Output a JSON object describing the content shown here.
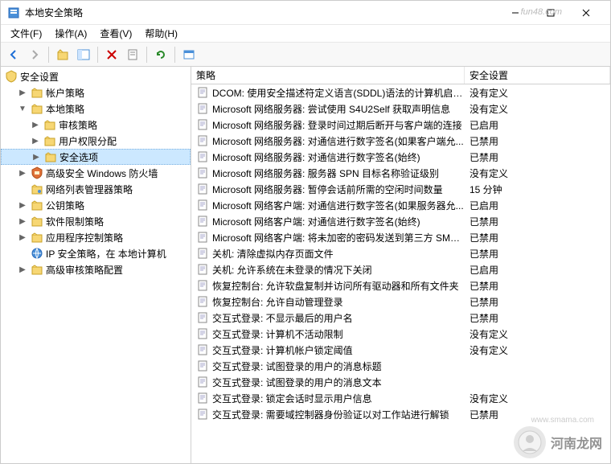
{
  "window": {
    "title": "本地安全策略"
  },
  "watermarks": {
    "top": "fun48.com",
    "bottom_url": "www.smama.com",
    "bottom_text": "河南龙网"
  },
  "menu": {
    "file": "文件(F)",
    "action": "操作(A)",
    "view": "查看(V)",
    "help": "帮助(H)"
  },
  "tree": {
    "root": "安全设置",
    "items": [
      {
        "label": "帐户策略",
        "indent": 1,
        "expander": "▶",
        "icon": "folder"
      },
      {
        "label": "本地策略",
        "indent": 1,
        "expander": "▼",
        "icon": "folder"
      },
      {
        "label": "审核策略",
        "indent": 2,
        "expander": "▶",
        "icon": "folder"
      },
      {
        "label": "用户权限分配",
        "indent": 2,
        "expander": "▶",
        "icon": "folder"
      },
      {
        "label": "安全选项",
        "indent": 2,
        "expander": "▶",
        "icon": "folder",
        "selected": true
      },
      {
        "label": "高级安全 Windows 防火墙",
        "indent": 1,
        "expander": "▶",
        "icon": "firewall"
      },
      {
        "label": "网络列表管理器策略",
        "indent": 1,
        "expander": "",
        "icon": "folder-net"
      },
      {
        "label": "公钥策略",
        "indent": 1,
        "expander": "▶",
        "icon": "folder"
      },
      {
        "label": "软件限制策略",
        "indent": 1,
        "expander": "▶",
        "icon": "folder"
      },
      {
        "label": "应用程序控制策略",
        "indent": 1,
        "expander": "▶",
        "icon": "folder"
      },
      {
        "label": "IP 安全策略，在 本地计算机",
        "indent": 1,
        "expander": "",
        "icon": "ip"
      },
      {
        "label": "高级审核策略配置",
        "indent": 1,
        "expander": "▶",
        "icon": "folder"
      }
    ]
  },
  "list": {
    "headers": {
      "policy": "策略",
      "security": "安全设置"
    },
    "rows": [
      {
        "policy": "DCOM: 使用安全描述符定义语言(SDDL)语法的计算机启动...",
        "security": "没有定义"
      },
      {
        "policy": "Microsoft 网络服务器: 尝试使用 S4U2Self 获取声明信息",
        "security": "没有定义"
      },
      {
        "policy": "Microsoft 网络服务器: 登录时间过期后断开与客户端的连接",
        "security": "已启用"
      },
      {
        "policy": "Microsoft 网络服务器: 对通信进行数字签名(如果客户端允...",
        "security": "已禁用"
      },
      {
        "policy": "Microsoft 网络服务器: 对通信进行数字签名(始终)",
        "security": "已禁用"
      },
      {
        "policy": "Microsoft 网络服务器: 服务器 SPN 目标名称验证级别",
        "security": "没有定义"
      },
      {
        "policy": "Microsoft 网络服务器: 暂停会话前所需的空闲时间数量",
        "security": "15 分钟"
      },
      {
        "policy": "Microsoft 网络客户端: 对通信进行数字签名(如果服务器允...",
        "security": "已启用"
      },
      {
        "policy": "Microsoft 网络客户端: 对通信进行数字签名(始终)",
        "security": "已禁用"
      },
      {
        "policy": "Microsoft 网络客户端: 将未加密的密码发送到第三方 SMB...",
        "security": "已禁用"
      },
      {
        "policy": "关机: 清除虚拟内存页面文件",
        "security": "已禁用"
      },
      {
        "policy": "关机: 允许系统在未登录的情况下关闭",
        "security": "已启用"
      },
      {
        "policy": "恢复控制台: 允许软盘复制并访问所有驱动器和所有文件夹",
        "security": "已禁用"
      },
      {
        "policy": "恢复控制台: 允许自动管理登录",
        "security": "已禁用"
      },
      {
        "policy": "交互式登录: 不显示最后的用户名",
        "security": "已禁用"
      },
      {
        "policy": "交互式登录: 计算机不活动限制",
        "security": "没有定义"
      },
      {
        "policy": "交互式登录: 计算机帐户锁定阈值",
        "security": "没有定义"
      },
      {
        "policy": "交互式登录: 试图登录的用户的消息标题",
        "security": ""
      },
      {
        "policy": "交互式登录: 试图登录的用户的消息文本",
        "security": ""
      },
      {
        "policy": "交互式登录: 锁定会话时显示用户信息",
        "security": "没有定义"
      },
      {
        "policy": "交互式登录: 需要域控制器身份验证以对工作站进行解锁",
        "security": "已禁用"
      }
    ]
  }
}
